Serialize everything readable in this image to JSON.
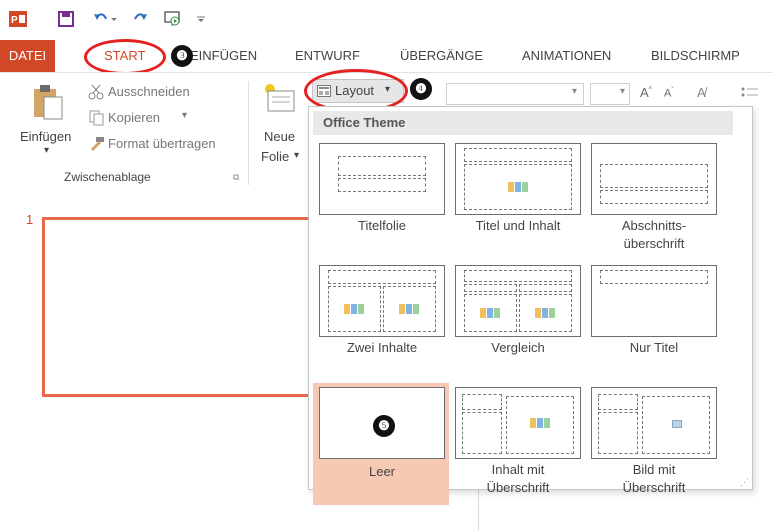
{
  "quick_access": {
    "app_icon": "powerpoint-icon",
    "items": [
      "save-icon",
      "undo-icon",
      "redo-icon",
      "start-from-beginning-icon",
      "customize-qat-icon"
    ]
  },
  "tabs": {
    "datei": "DATEI",
    "start": "START",
    "einfuegen": "EINFÜGEN",
    "entwurf": "ENTWURF",
    "uebergaenge": "ÜBERGÄNGE",
    "animationen": "ANIMATIONEN",
    "bildschirm": "BILDSCHIRMP"
  },
  "badges": {
    "b3": "❸",
    "b4": "❹",
    "b5": "❺"
  },
  "ribbon": {
    "clipboard": {
      "paste": "Einfügen",
      "cut": "Ausschneiden",
      "copy": "Kopieren",
      "format_painter": "Format übertragen",
      "group_label": "Zwischenablage"
    },
    "slides": {
      "new_slide_line1": "Neue",
      "new_slide_line2": "Folie",
      "layout": "Layout"
    }
  },
  "slide_panel": {
    "number": "1"
  },
  "layout_menu": {
    "header": "Office Theme",
    "layouts": [
      "Titelfolie",
      "Titel und Inhalt",
      "Abschnitts-\nüberschrift",
      "Zwei Inhalte",
      "Vergleich",
      "Nur Titel",
      "Leer",
      "Inhalt mit\nÜberschrift",
      "Bild mit\nÜberschrift"
    ]
  },
  "colors": {
    "accent": "#d24726",
    "highlight_ring": "#e52020",
    "selected_tile": "#f6c9b4"
  }
}
